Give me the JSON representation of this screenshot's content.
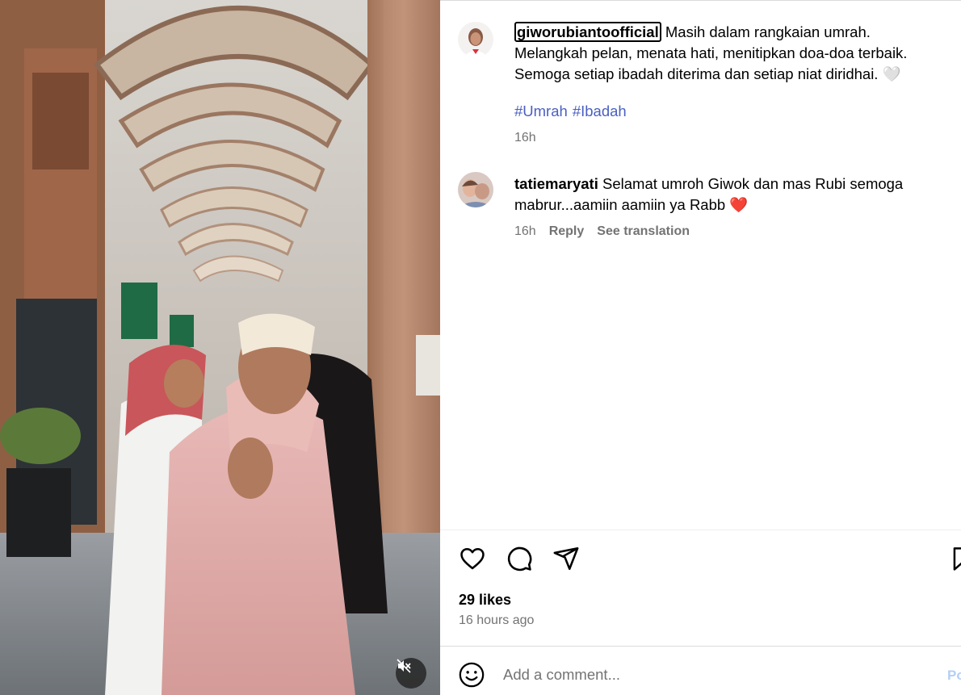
{
  "post": {
    "author": "giworubiantoofficial",
    "caption_lines": [
      "Masih dalam rangkaian umrah.",
      "Melangkah pelan, menata hati, menitipkan doa-doa terbaik.",
      "Semoga setiap ibadah diterima dan setiap niat diridhai. 🤍"
    ],
    "hashtags": [
      "#Umrah",
      "#Ibadah"
    ],
    "time": "16h",
    "likes": "29 likes",
    "posted_ago": "16 hours ago"
  },
  "comments": [
    {
      "username": "tatiemaryati",
      "text": "Selamat umroh Giwok dan mas Rubi semoga mabrur...aamiin aamiin ya Rabb ❤️",
      "time": "16h",
      "reply_label": "Reply",
      "translate_label": "See translation"
    }
  ],
  "actions": {
    "icons": [
      "heart-icon",
      "comment-icon",
      "share-icon",
      "bookmark-icon"
    ]
  },
  "comment_box": {
    "placeholder": "Add a comment...",
    "post_label": "Po"
  },
  "media": {
    "mute_icon": "speaker-muted-icon"
  },
  "colors": {
    "hashtag": "#4a5fc1",
    "secondary_text": "#737373",
    "post_button": "#b3cff6",
    "heart": "#ed4956"
  }
}
